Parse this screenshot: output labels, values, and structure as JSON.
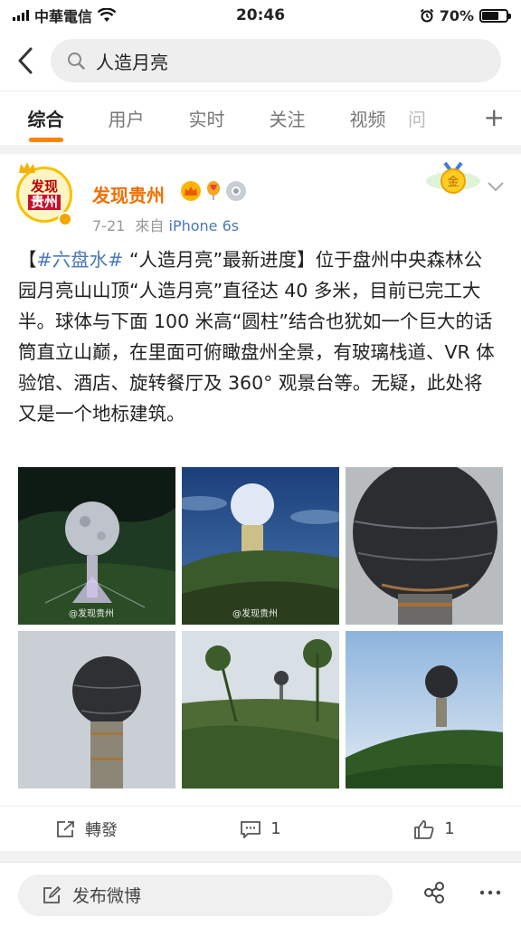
{
  "status_bar": {
    "carrier": "中華電信",
    "time": "20:46",
    "battery_percent": "70%",
    "battery_level": 0.7
  },
  "search": {
    "query": "人造月亮"
  },
  "tabs": [
    {
      "label": "综合",
      "active": true
    },
    {
      "label": "用户",
      "active": false
    },
    {
      "label": "实时",
      "active": false
    },
    {
      "label": "关注",
      "active": false
    },
    {
      "label": "视频",
      "active": false
    },
    {
      "label": "问",
      "active": false
    }
  ],
  "tabs_more": "+",
  "post": {
    "author": "发现贵州",
    "avatar_text_top": "发现",
    "avatar_text_bottom": "贵州",
    "medal_text": "金",
    "date": "7-21",
    "source_prefix": "來自",
    "source": "iPhone 6s",
    "hashtag": "#六盘水#",
    "text_open": "【",
    "text_after_tag": " “人造月亮”最新进度】位于盘州中央森林公园月亮山山顶“人造月亮”直径达 40 多米，目前已完工大半。球体与下面 100 米高“圆柱”结合也犹如一个巨大的话筒直立山巅，在里面可俯瞰盘州全景，有玻璃栈道、VR 体验馆、酒店、旋转餐厅及 360° 观景台等。无疑，此处将又是一个地标建筑。",
    "watermark": "@发现贵州",
    "actions": {
      "repost_label": "轉發",
      "comment_count": "1",
      "like_count": "1"
    }
  },
  "bottom_bar": {
    "compose_label": "发布微博"
  },
  "colors": {
    "accent": "#ff8200",
    "author": "#f07000",
    "link": "#4a78b8"
  }
}
